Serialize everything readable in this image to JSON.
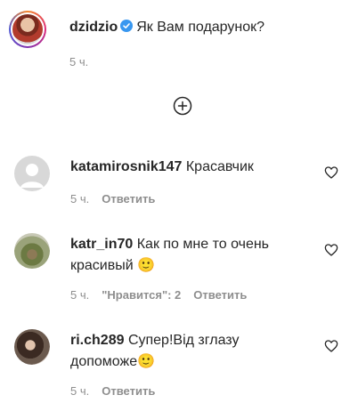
{
  "post": {
    "username": "dzidzio",
    "verified": true,
    "caption": "Як Вам подарунок?",
    "time": "5 ч."
  },
  "load_more": {
    "icon": "plus-circle-icon"
  },
  "comments": [
    {
      "username": "katamirosnik147",
      "text": "Красавчик",
      "time": "5 ч.",
      "likes": "",
      "reply": "Ответить"
    },
    {
      "username": "katr_in70",
      "text_line1": "Как по мне то очень",
      "text_line2": "красивый 🙂",
      "time": "5 ч.",
      "likes": "\"Нравится\": 2",
      "reply": "Ответить"
    },
    {
      "username": "ri.ch289",
      "text_line1": "Супер!Від зглазу",
      "text_line2": "допоможе🙂",
      "time": "5 ч.",
      "likes": "",
      "reply": "Ответить"
    }
  ],
  "colors": {
    "text": "#262626",
    "muted": "#8e8e8e",
    "verified": "#3897f0"
  }
}
